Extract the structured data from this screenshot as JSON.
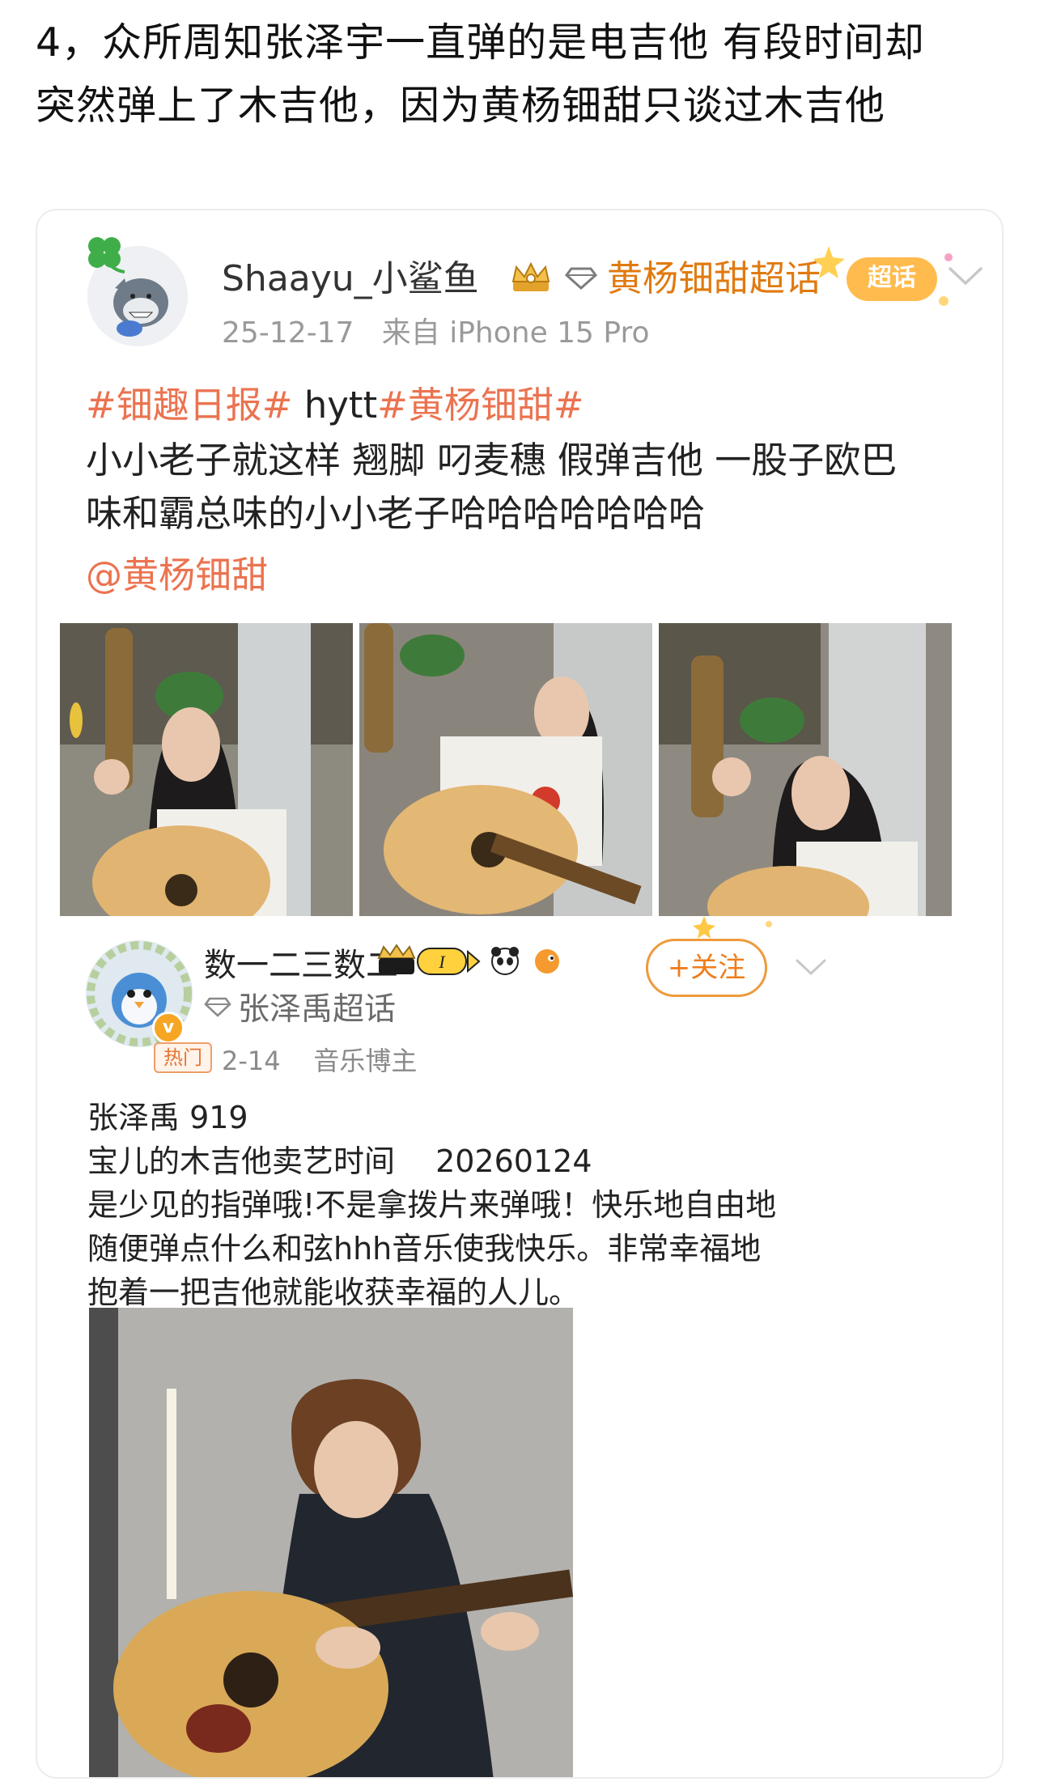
{
  "intro": {
    "line1": "4，众所周知张泽宇一直弹的是电吉他 有段时间却",
    "line2": "突然弹上了木吉他，因为黄杨钿甜只谈过木吉他"
  },
  "post1": {
    "username": "Shaayu_小鲨鱼",
    "supertopic": "黄杨钿甜超话",
    "sticker_label": "超话",
    "date": "25-12-17",
    "source": "来自 iPhone 15 Pro",
    "tag1": "#钿趣日报#",
    "tag_plain": " hytt",
    "tag2": "#黄杨钿甜#",
    "body_line1": "小小老子就这样 翘脚 叼麦穗 假弹吉他 一股子欧巴",
    "body_line2": "味和霸总味的小小老子哈哈哈哈哈哈哈",
    "mention": "@黄杨钿甜",
    "accent_color": "#eb7350"
  },
  "post2": {
    "username": "数一二三数二",
    "level_badge": "I",
    "verified_mark": "v",
    "supertopic": "张泽禹超话",
    "follow_label": "+关注",
    "hot_label": "热门",
    "date": "2-14",
    "role": "音乐博主",
    "line1": "张泽禹 919",
    "line2": "宝儿的木吉他卖艺时间　 20260124",
    "line3": "是少见的指弹哦!不是拿拨片来弹哦！快乐地自由地",
    "line4": "随便弹点什么和弦hhh音乐使我快乐。非常幸福地",
    "line5": "抱着一把吉他就能收获幸福的人儿。",
    "accent_color": "#ef7d1c"
  },
  "icons": {
    "header_crown": "crown-icon",
    "supertopic_marker": "diamond-icon",
    "menu": "chevron-down-icon"
  }
}
